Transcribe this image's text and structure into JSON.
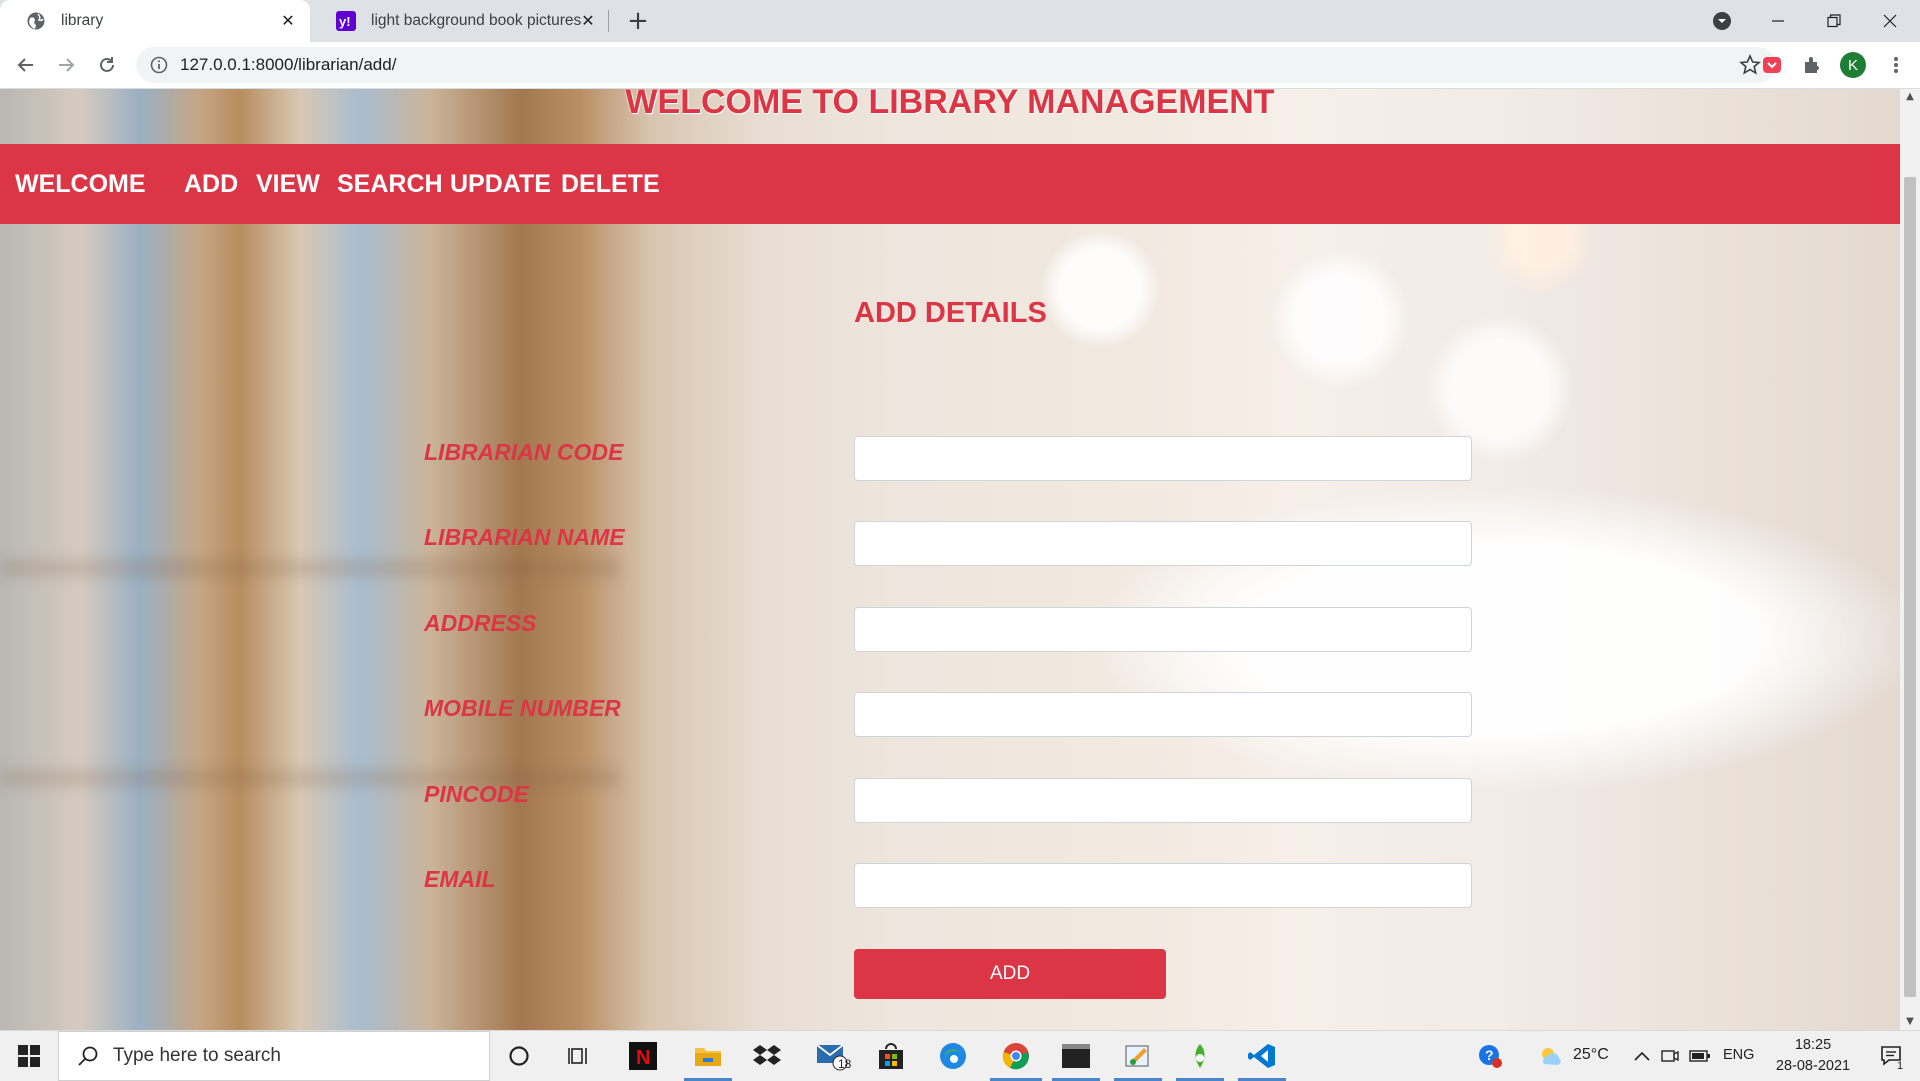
{
  "browser": {
    "tabs": [
      {
        "title": "library",
        "active": true
      },
      {
        "title": "light background book pictures -",
        "active": false
      }
    ],
    "url": "127.0.0.1:8000/librarian/add/",
    "profile_initial": "K"
  },
  "page": {
    "heading": "WELCOME TO LIBRARY MANAGEMENT",
    "nav": [
      "WELCOME",
      "ADD",
      "VIEW",
      "SEARCH",
      "UPDATE",
      "DELETE"
    ],
    "form_title": "ADD DETAILS",
    "fields": [
      {
        "label": "LIBRARIAN CODE",
        "value": ""
      },
      {
        "label": "LIBRARIAN NAME",
        "value": ""
      },
      {
        "label": "ADDRESS",
        "value": ""
      },
      {
        "label": "MOBILE NUMBER",
        "value": ""
      },
      {
        "label": "PINCODE",
        "value": ""
      },
      {
        "label": "EMAIL",
        "value": ""
      }
    ],
    "submit_label": "ADD",
    "colors": {
      "accent": "#dc3545"
    }
  },
  "taskbar": {
    "search_placeholder": "Type here to search",
    "mail_badge": "18",
    "temperature": "25°C",
    "language": "ENG",
    "time": "18:25",
    "date": "28-08-2021",
    "notification_count": "1"
  }
}
